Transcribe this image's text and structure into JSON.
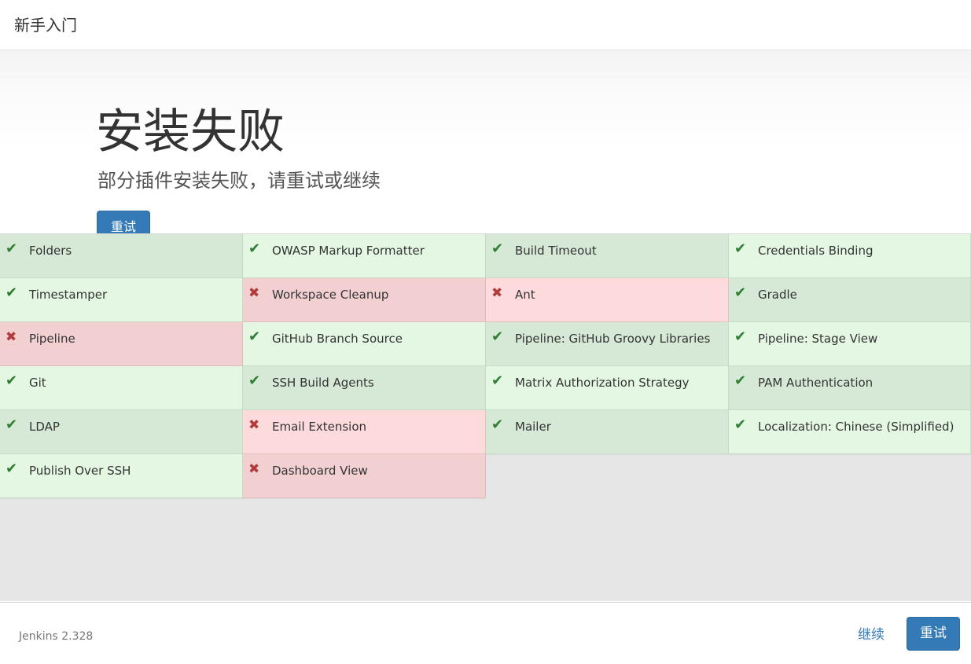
{
  "header": {
    "title": "新手入门"
  },
  "hero": {
    "title": "安装失败",
    "subtitle": "部分插件安装失败，请重试或继续",
    "retry_label": "重试"
  },
  "plugins": [
    {
      "name": "Folders",
      "status": "success",
      "icon": "check-icon"
    },
    {
      "name": "OWASP Markup Formatter",
      "status": "success",
      "icon": "check-icon"
    },
    {
      "name": "Build Timeout",
      "status": "success",
      "icon": "check-icon"
    },
    {
      "name": "Credentials Binding",
      "status": "success",
      "icon": "check-icon"
    },
    {
      "name": "Timestamper",
      "status": "success",
      "icon": "check-icon"
    },
    {
      "name": "Workspace Cleanup",
      "status": "failed",
      "icon": "cross-icon"
    },
    {
      "name": "Ant",
      "status": "failed",
      "icon": "cross-icon"
    },
    {
      "name": "Gradle",
      "status": "success",
      "icon": "check-icon"
    },
    {
      "name": "Pipeline",
      "status": "failed",
      "icon": "cross-icon"
    },
    {
      "name": "GitHub Branch Source",
      "status": "success",
      "icon": "check-icon"
    },
    {
      "name": "Pipeline: GitHub Groovy Libraries",
      "status": "success",
      "icon": "check-icon"
    },
    {
      "name": "Pipeline: Stage View",
      "status": "success",
      "icon": "check-icon"
    },
    {
      "name": "Git",
      "status": "success",
      "icon": "check-icon"
    },
    {
      "name": "SSH Build Agents",
      "status": "success",
      "icon": "check-icon"
    },
    {
      "name": "Matrix Authorization Strategy",
      "status": "success",
      "icon": "check-icon"
    },
    {
      "name": "PAM Authentication",
      "status": "success",
      "icon": "check-icon"
    },
    {
      "name": "LDAP",
      "status": "success",
      "icon": "check-icon"
    },
    {
      "name": "Email Extension",
      "status": "failed",
      "icon": "cross-icon"
    },
    {
      "name": "Mailer",
      "status": "success",
      "icon": "check-icon"
    },
    {
      "name": "Localization: Chinese (Simplified)",
      "status": "success",
      "icon": "check-icon"
    },
    {
      "name": "Publish Over SSH",
      "status": "success",
      "icon": "check-icon"
    },
    {
      "name": "Dashboard View",
      "status": "failed",
      "icon": "cross-icon"
    }
  ],
  "footer": {
    "version": "Jenkins 2.328",
    "continue_label": "继续",
    "retry_label": "重试"
  },
  "colors": {
    "primary": "#337ab7",
    "success_bg": "#d6e9d6",
    "success_bg_alt": "#e3f7e3",
    "fail_bg": "#f2d0d2",
    "fail_bg_alt": "#fddadb",
    "check": "#2e7d32",
    "cross": "#b23b3b"
  }
}
